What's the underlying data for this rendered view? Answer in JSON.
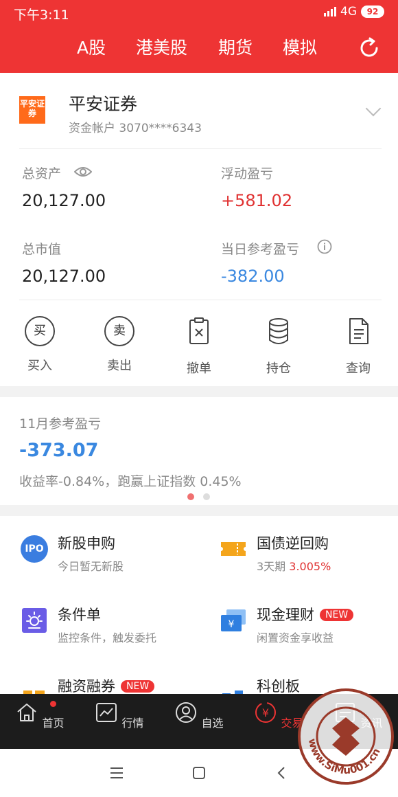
{
  "status": {
    "time": "下午3:11",
    "network": "4G",
    "battery": "92"
  },
  "topnav": {
    "tabs": [
      "A股",
      "港美股",
      "期货",
      "模拟"
    ]
  },
  "broker": {
    "logo_text": "平安证券",
    "name": "平安证券",
    "account": "资金帐户 3070****6343"
  },
  "stats": {
    "total_assets_label": "总资产",
    "total_assets": "20,127.00",
    "float_pnl_label": "浮动盈亏",
    "float_pnl": "+581.02",
    "market_value_label": "总市值",
    "market_value": "20,127.00",
    "day_pnl_label": "当日参考盈亏",
    "day_pnl": "-382.00"
  },
  "actions": [
    {
      "label": "买入",
      "icon": "buy-icon",
      "glyph": "买"
    },
    {
      "label": "卖出",
      "icon": "sell-icon",
      "glyph": "卖"
    },
    {
      "label": "撤单",
      "icon": "cancel-order-icon"
    },
    {
      "label": "持仓",
      "icon": "holdings-icon"
    },
    {
      "label": "查询",
      "icon": "query-icon"
    }
  ],
  "monthly": {
    "label": "11月参考盈亏",
    "value": "-373.07",
    "desc": "收益率-0.84%，跑赢上证指数 0.45%"
  },
  "features": {
    "ipo": {
      "icon_text": "IPO",
      "title": "新股申购",
      "sub": "今日暂无新股"
    },
    "repo": {
      "title": "国债逆回购",
      "sub_prefix": "3天期",
      "rate": "3.005%"
    },
    "condition": {
      "title": "条件单",
      "sub": "监控条件，触发委托"
    },
    "cash": {
      "title": "现金理财",
      "badge": "NEW",
      "sub": "闲置资金享收益",
      "icon_text": "¥"
    },
    "margin": {
      "title": "融资融券",
      "badge": "NEW"
    },
    "star": {
      "title": "科创板"
    }
  },
  "tabbar": [
    {
      "label": "首页",
      "icon": "home-icon"
    },
    {
      "label": "行情",
      "icon": "market-icon"
    },
    {
      "label": "自选",
      "icon": "watchlist-icon"
    },
    {
      "label": "交易",
      "icon": "trade-icon",
      "glyph": "¥"
    },
    {
      "label": "资讯",
      "icon": "news-icon"
    }
  ],
  "watermark_text": "www.SiMu001.cn",
  "colors": {
    "brand_red": "#ee3434",
    "gain_red": "#e03131",
    "loss_blue": "#3a88e0"
  }
}
